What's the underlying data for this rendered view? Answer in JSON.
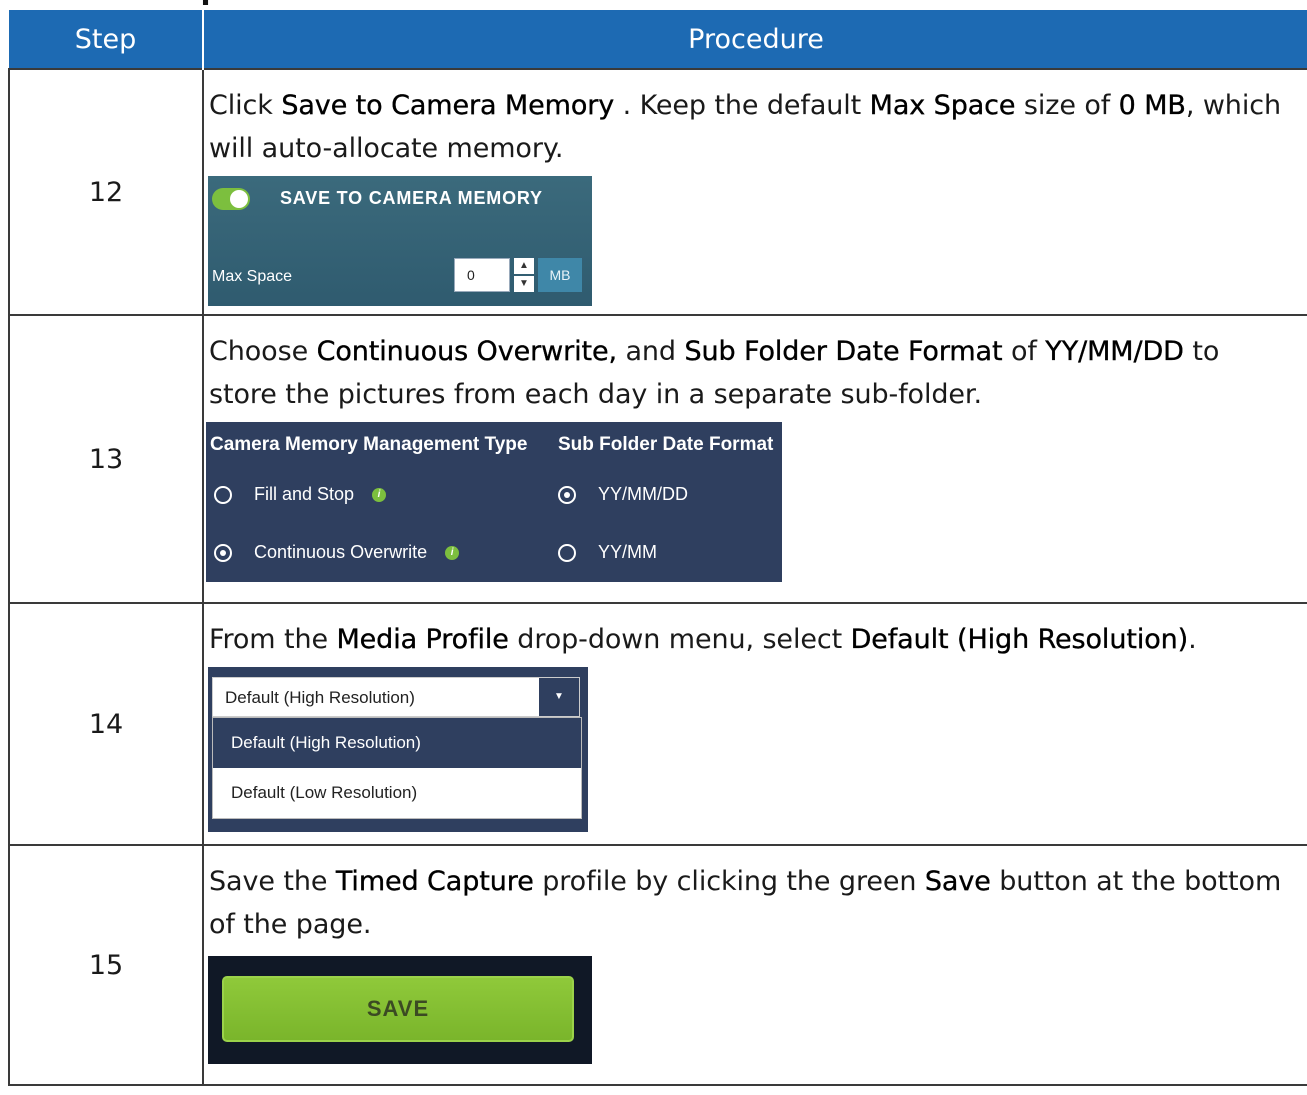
{
  "table": {
    "header": {
      "step": "Step",
      "procedure": "Procedure"
    },
    "rows": [
      {
        "step": "12",
        "text_parts": [
          {
            "t": "Click ",
            "b": false
          },
          {
            "t": "Save to Camera Memory",
            "b": true
          },
          {
            "t": " . Keep the default ",
            "b": false
          },
          {
            "t": "Max Space",
            "b": true
          },
          {
            "t": " size of ",
            "b": false
          },
          {
            "t": "0 MB",
            "b": true
          },
          {
            "t": ", which will auto-allocate memory.",
            "b": false
          }
        ],
        "shot": {
          "title": "SAVE TO CAMERA MEMORY",
          "toggle_on": true,
          "max_space_label": "Max Space",
          "max_space_value": "0",
          "unit": "MB"
        }
      },
      {
        "step": "13",
        "text_parts": [
          {
            "t": "Choose ",
            "b": false
          },
          {
            "t": "Continuous Overwrite,",
            "b": true
          },
          {
            "t": " and ",
            "b": false
          },
          {
            "t": "Sub Folder Date Format",
            "b": true
          },
          {
            "t": " of ",
            "b": false
          },
          {
            "t": "YY/MM/DD",
            "b": true
          },
          {
            "t": " to store the pictures from each day in a separate sub-folder.",
            "b": false
          }
        ],
        "shot": {
          "left_header": "Camera Memory Management Type",
          "right_header": "Sub Folder Date Format",
          "left_options": [
            {
              "label": "Fill and Stop",
              "selected": false
            },
            {
              "label": "Continuous Overwrite",
              "selected": true
            }
          ],
          "right_options": [
            {
              "label": "YY/MM/DD",
              "selected": true
            },
            {
              "label": "YY/MM",
              "selected": false
            }
          ]
        }
      },
      {
        "step": "14",
        "text_parts": [
          {
            "t": "From the ",
            "b": false
          },
          {
            "t": "Media Profile",
            "b": true
          },
          {
            "t": " drop-down menu, select ",
            "b": false
          },
          {
            "t": "Default (High Resolution)",
            "b": true
          },
          {
            "t": ".",
            "b": false
          }
        ],
        "shot": {
          "selected_value": "Default (High Resolution)",
          "options": [
            "Default (High Resolution)",
            "Default (Low Resolution)"
          ]
        }
      },
      {
        "step": "15",
        "text_parts": [
          {
            "t": "Save the ",
            "b": false
          },
          {
            "t": "Timed Capture",
            "b": true
          },
          {
            "t": " profile by clicking the green ",
            "b": false
          },
          {
            "t": "Save",
            "b": true
          },
          {
            "t": " button at the bottom of the page.",
            "b": false
          }
        ],
        "shot": {
          "save_label": "SAVE"
        }
      }
    ]
  },
  "colors": {
    "header_bg": "#1d6ab3",
    "toggle_green": "#7cbf3e",
    "save_green": "#86c034",
    "panel_dark": "#2f3f5f"
  }
}
